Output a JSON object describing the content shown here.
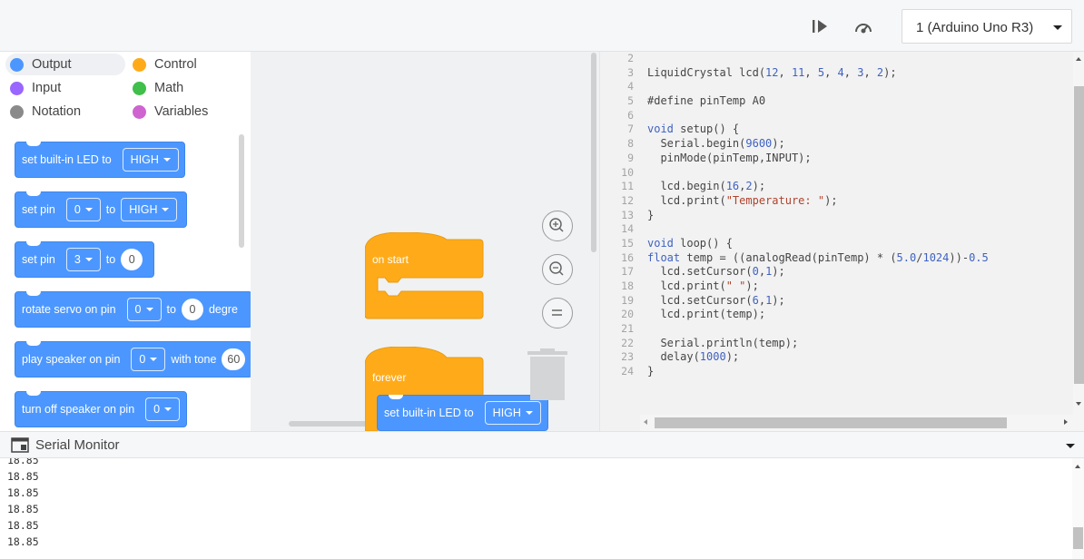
{
  "toolbar": {
    "board_label": "1 (Arduino Uno R3)",
    "step_icon": "step-forward-icon",
    "speed_icon": "speedometer-icon"
  },
  "categories": [
    {
      "label": "Output",
      "color": "#4c97ff",
      "active": true
    },
    {
      "label": "Control",
      "color": "#ffab19",
      "active": false
    },
    {
      "label": "Input",
      "color": "#9966ff",
      "active": false
    },
    {
      "label": "Math",
      "color": "#40bf4a",
      "active": false
    },
    {
      "label": "Notation",
      "color": "#8a8a8a",
      "active": false
    },
    {
      "label": "Variables",
      "color": "#cf63cf",
      "active": false
    }
  ],
  "blocks": {
    "set_led": {
      "text": "set built-in LED to",
      "value": "HIGH"
    },
    "set_pin": {
      "text": "set pin",
      "pin": "0",
      "to": "to",
      "value": "HIGH"
    },
    "set_pin_analog": {
      "text": "set pin",
      "pin": "3",
      "to": "to",
      "value": "0"
    },
    "servo": {
      "text": "rotate servo on pin",
      "pin": "0",
      "to": "to",
      "value": "0",
      "suffix": "degre"
    },
    "speaker": {
      "text": "play speaker on pin",
      "pin": "0",
      "with": "with tone",
      "value": "60"
    },
    "speaker_off": {
      "text": "turn off speaker on pin",
      "pin": "0"
    }
  },
  "workspace": {
    "on_start": "on start",
    "forever": "forever",
    "forever_block": {
      "text": "set built-in LED to",
      "value": "HIGH"
    },
    "zoom_in_icon": "zoom-in-icon",
    "zoom_out_icon": "zoom-out-icon",
    "zoom_reset_icon": "zoom-reset-icon",
    "trash_icon": "trash-icon"
  },
  "editor": {
    "line_numbers": [
      "2",
      "3",
      "4",
      "5",
      "6",
      "7",
      "8",
      "9",
      "10",
      "11",
      "12",
      "13",
      "14",
      "15",
      "16",
      "17",
      "18",
      "19",
      "20",
      "21",
      "22",
      "23",
      "24"
    ],
    "lines": [
      "",
      "LiquidCrystal lcd(12, 11, 5, 4, 3, 2);",
      "",
      "#define pinTemp A0",
      "",
      "void setup() {",
      "  Serial.begin(9600);",
      "  pinMode(pinTemp,INPUT);",
      "",
      "  lcd.begin(16,2);",
      "  lcd.print(\"Temperature: \");",
      "}",
      "",
      "void loop() {",
      "float temp = ((analogRead(pinTemp) * (5.0/1024))-0.5",
      "  lcd.setCursor(0,1);",
      "  lcd.print(\" \");",
      "  lcd.setCursor(6,1);",
      "  lcd.print(temp);",
      "",
      "  Serial.println(temp);",
      "  delay(1000);",
      "}"
    ]
  },
  "serial": {
    "title": "Serial Monitor",
    "icon": "serial-monitor-icon",
    "lines": [
      "18.85",
      "18.85",
      "18.85",
      "18.85",
      "18.85",
      "18.85"
    ]
  }
}
